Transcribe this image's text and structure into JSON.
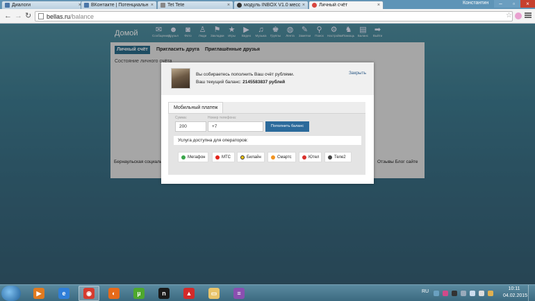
{
  "browser": {
    "tabs": [
      {
        "title": "Диалоги",
        "favicon_color": "#4a76a8",
        "active": false
      },
      {
        "title": "ВКонтакте | Потенциальн",
        "favicon_color": "#4a76a8",
        "active": false
      },
      {
        "title": "Tet Tete",
        "favicon_color": "#888888",
        "active": false
      },
      {
        "title": "модуль INBOX V1.0 месс",
        "favicon_color": "#333333",
        "active": false
      },
      {
        "title": "Личный счёт",
        "favicon_color": "#d9463f",
        "active": true
      }
    ],
    "user_name": "Константин",
    "url_host": "bellas.ru",
    "url_path": "/balance"
  },
  "site": {
    "logo": "Домой",
    "nav": [
      {
        "label": "Сообщения",
        "icon": "envelope-icon",
        "glyph": "✉"
      },
      {
        "label": "Друзья",
        "icon": "person-icon",
        "glyph": "☻"
      },
      {
        "label": "Фото",
        "icon": "camera-icon",
        "glyph": "◙"
      },
      {
        "label": "Люди",
        "icon": "user-icon",
        "glyph": "♙"
      },
      {
        "label": "Закладки",
        "icon": "bookmark-icon",
        "glyph": "⚑"
      },
      {
        "label": "Игры",
        "icon": "star-icon",
        "glyph": "★"
      },
      {
        "label": "Видео",
        "icon": "video-icon",
        "glyph": "▶"
      },
      {
        "label": "Музыка",
        "icon": "music-icon",
        "glyph": "♫"
      },
      {
        "label": "Группы",
        "icon": "group-icon",
        "glyph": "♚"
      },
      {
        "label": "Лента",
        "icon": "globe-icon",
        "glyph": "◍"
      },
      {
        "label": "Заметки",
        "icon": "notes-icon",
        "glyph": "✎"
      },
      {
        "label": "Поиск",
        "icon": "search-icon",
        "glyph": "⚲"
      },
      {
        "label": "Настройки",
        "icon": "gear-icon",
        "glyph": "⚙"
      },
      {
        "label": "Помощь",
        "icon": "help-icon",
        "glyph": "♞"
      },
      {
        "label": "Баланс",
        "icon": "wallet-icon",
        "glyph": "▤"
      },
      {
        "label": "Выйти",
        "icon": "exit-icon",
        "glyph": "➡"
      }
    ],
    "tabs": [
      "Личный счёт",
      "Пригласить друга",
      "Приглашённые друзья"
    ],
    "section_title": "Состояние личного счёта",
    "footer_left": "Бернаульская социальн",
    "footer_right": "Отзывы   Блог сайте"
  },
  "modal": {
    "message": "Вы собираетесь пополнить Ваш счёт рублями.",
    "balance_prefix": "Ваш текущий баланс:",
    "balance_value": "2145583837 рублей",
    "close_label": "Закрыть",
    "payment_tab": "Мобильный платеж",
    "amount_label": "Сумма:",
    "amount_value": "200",
    "phone_label": "Номер телефона:",
    "phone_value": "+7",
    "submit_label": "Пополнить баланс",
    "operators_title": "Услуга доступна для операторов:",
    "operators": [
      {
        "name": "Мегафон",
        "color": "#3aa54a"
      },
      {
        "name": "МТС",
        "color": "#e2231a"
      },
      {
        "name": "Билайн",
        "color": "#f3c210"
      },
      {
        "name": "Смартс",
        "color": "#f29422"
      },
      {
        "name": "Ютел",
        "color": "#d9302c"
      },
      {
        "name": "Теле2",
        "color": "#444444"
      }
    ]
  },
  "taskbar": {
    "apps": [
      {
        "name": "media-player-icon",
        "color": "#e07a20",
        "glyph": "▶"
      },
      {
        "name": "internet-explorer-icon",
        "color": "#2f7ed8",
        "glyph": "e"
      },
      {
        "name": "chrome-icon",
        "color": "#d63b2f",
        "glyph": "◉"
      },
      {
        "name": "firefox-icon",
        "color": "#e66a1a",
        "glyph": "◐"
      },
      {
        "name": "utorrent-icon",
        "color": "#4ea82e",
        "glyph": "µ"
      },
      {
        "name": "app-n-icon",
        "color": "#1a1a1a",
        "glyph": "n"
      },
      {
        "name": "app-red-icon",
        "color": "#d32a2a",
        "glyph": "▲"
      },
      {
        "name": "folder-icon",
        "color": "#e9c46a",
        "glyph": "▭"
      },
      {
        "name": "archive-icon",
        "color": "#8a4fb0",
        "glyph": "≡"
      }
    ],
    "lang": "RU",
    "time": "10:11",
    "date": "04.02.2015"
  }
}
